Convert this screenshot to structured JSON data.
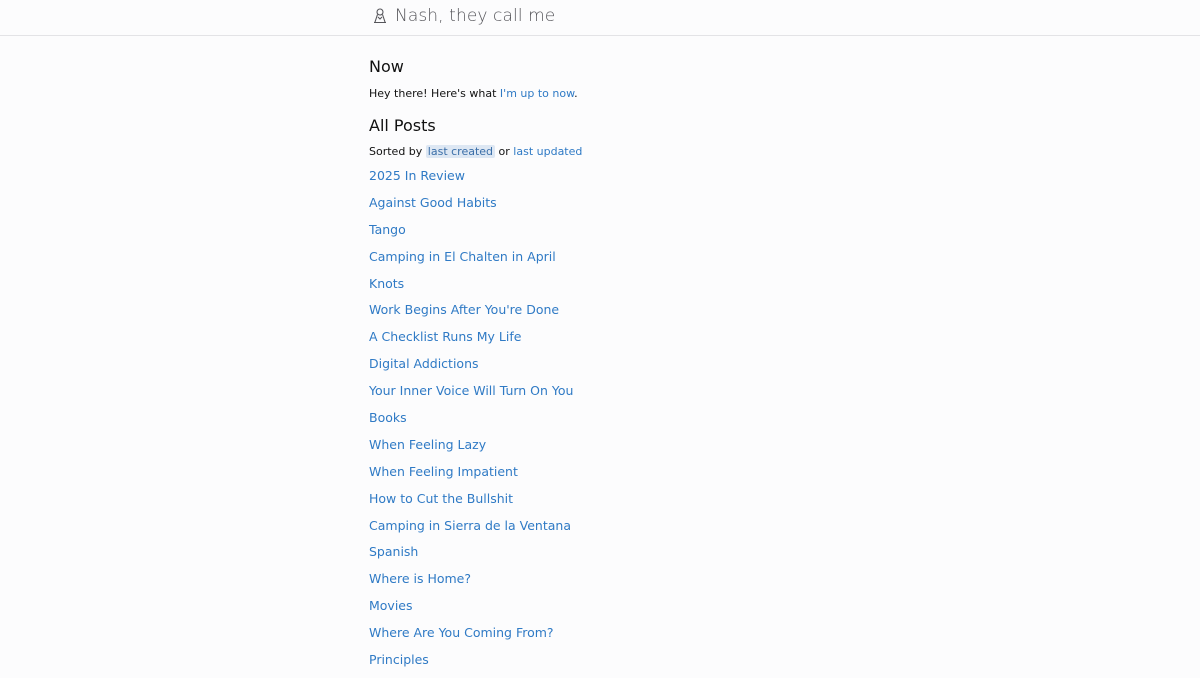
{
  "header": {
    "site_title": "Nash, they call me",
    "logo_icon": "camper-icon"
  },
  "now": {
    "heading": "Now",
    "intro_text": "Hey there! Here's what ",
    "link_label": "I'm up to now",
    "trailing": "."
  },
  "posts": {
    "heading": "All Posts",
    "sort_prefix": "Sorted by ",
    "sort_active": "last created",
    "sort_or": " or ",
    "sort_other": "last updated",
    "items": [
      "2025 In Review",
      "Against Good Habits",
      "Tango",
      "Camping in El Chalten in April",
      "Knots",
      "Work Begins After You're Done",
      "A Checklist Runs My Life",
      "Digital Addictions",
      "Your Inner Voice Will Turn On You",
      "Books",
      "When Feeling Lazy",
      "When Feeling Impatient",
      "How to Cut the Bullshit",
      "Camping in Sierra de la Ventana",
      "Spanish",
      "Where is Home?",
      "Movies",
      "Where Are You Coming From?",
      "Principles"
    ]
  },
  "colors": {
    "link": "#2f7ac5",
    "active_sort_bg": "#dde7f3",
    "background": "#fcfcfd",
    "divider": "#e3e3e6"
  }
}
